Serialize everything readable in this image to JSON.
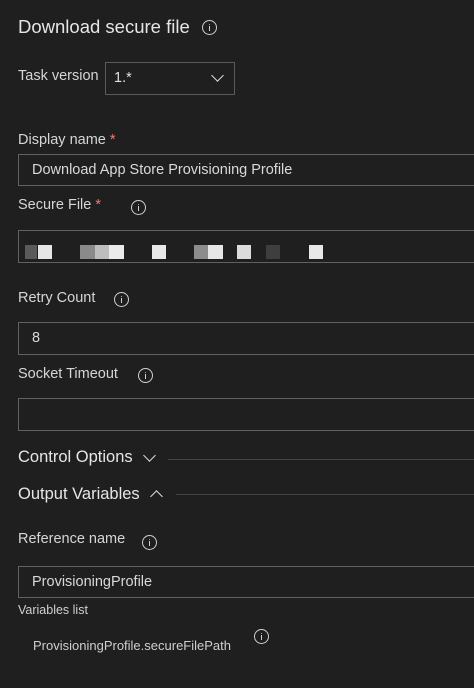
{
  "header": {
    "title": "Download secure file"
  },
  "task_version": {
    "label": "Task version",
    "value": "1.*"
  },
  "display_name": {
    "label": "Display name",
    "required_mark": "*",
    "value": "Download App Store Provisioning Profile"
  },
  "secure_file": {
    "label": "Secure File",
    "required_mark": "*",
    "value_note": "redacted"
  },
  "retry_count": {
    "label": "Retry Count",
    "value": "8"
  },
  "socket_timeout": {
    "label": "Socket Timeout",
    "value": ""
  },
  "control_options": {
    "label": "Control Options"
  },
  "output_variables": {
    "label": "Output Variables",
    "reference_name": {
      "label": "Reference name",
      "value": "ProvisioningProfile"
    },
    "variables_list_label": "Variables list",
    "variables": [
      "ProvisioningProfile.secureFilePath"
    ]
  },
  "colors": {
    "background": "#1f1f1f",
    "required": "#f07a6d",
    "border": "#616161"
  },
  "icons": [
    "info-icon",
    "chevron-down-icon",
    "chevron-up-icon"
  ]
}
